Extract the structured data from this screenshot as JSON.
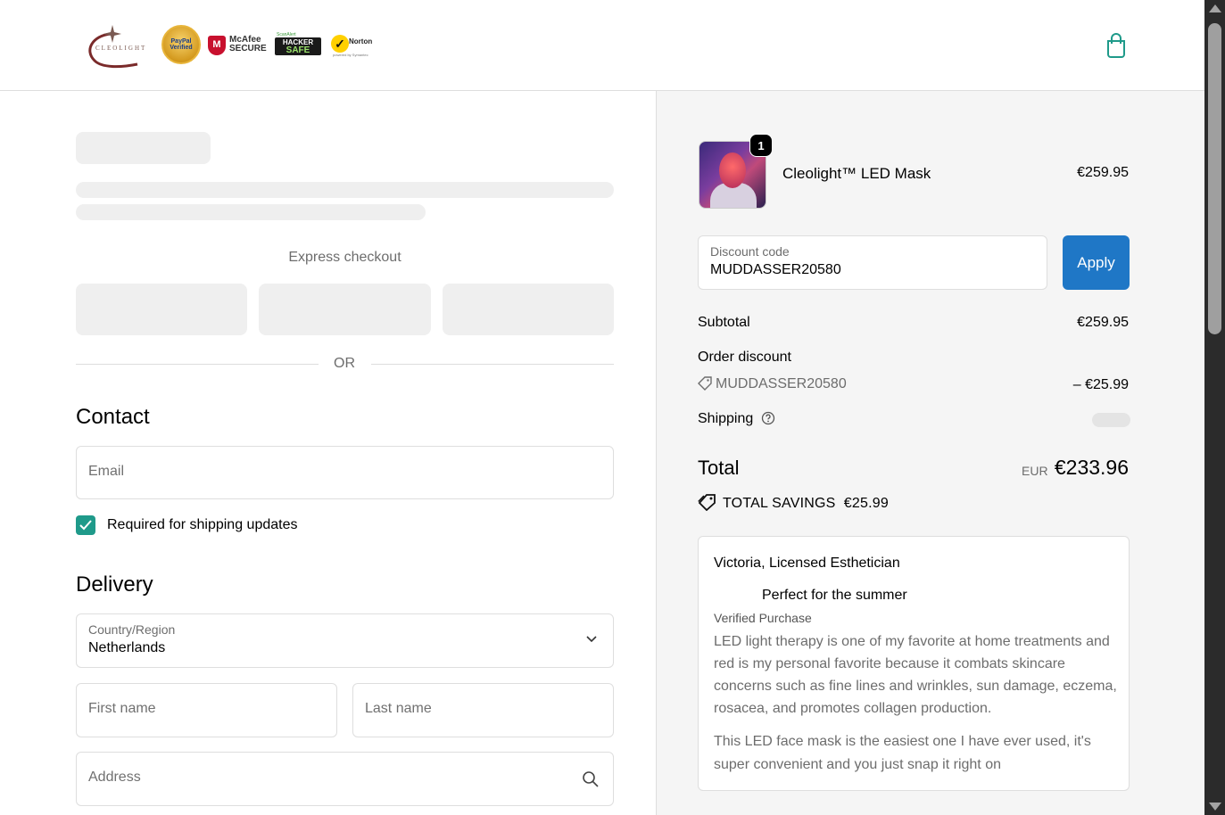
{
  "header": {
    "logo_text": "CLEOLIGHT",
    "logo_icon": "cleolight-logo-icon",
    "trust_badges": {
      "paypal": "PayPal Verified",
      "mcafee": "McAfee SECURE",
      "hacker_top": "ScanAlert",
      "hacker_line1": "HACKER",
      "hacker_line2": "SAFE",
      "norton": "Norton",
      "norton_sub": "SECURED",
      "norton_powered": "powered by Symantec"
    },
    "cart_icon": "shopping-bag-icon"
  },
  "checkout": {
    "express_label": "Express checkout",
    "or_label": "OR",
    "contact_title": "Contact",
    "email_placeholder": "Email",
    "shipping_updates_label": "Required for shipping updates",
    "shipping_updates_checked": true,
    "delivery_title": "Delivery",
    "country_label": "Country/Region",
    "country_value": "Netherlands",
    "first_name_placeholder": "First name",
    "last_name_placeholder": "Last name",
    "address_placeholder": "Address"
  },
  "summary": {
    "product": {
      "name": "Cleolight™ LED Mask",
      "price": "€259.95",
      "quantity": "1"
    },
    "discount": {
      "label": "Discount code",
      "value": "MUDDASSER20580",
      "apply_label": "Apply"
    },
    "subtotal_label": "Subtotal",
    "subtotal_value": "€259.95",
    "order_discount_label": "Order discount",
    "discount_code": "MUDDASSER20580",
    "discount_amount": "– €25.99",
    "shipping_label": "Shipping",
    "total_label": "Total",
    "total_currency": "EUR",
    "total_value": "€233.96",
    "savings_label": "TOTAL SAVINGS",
    "savings_value": "€25.99"
  },
  "review": {
    "author": "Victoria, Licensed Esthetician",
    "title": "Perfect for the summer",
    "verified": "Verified Purchase",
    "body1": "LED light therapy is one of my favorite at home treatments and red is my personal favorite because it combats skincare concerns such as fine lines and wrinkles, sun damage, eczema, rosacea, and promotes collagen production.",
    "body2": "This LED face mask is the easiest one I have ever used, it's super convenient and you just snap it right on"
  },
  "colors": {
    "accent": "#1f9a8a",
    "apply_button": "#1f77c6",
    "summary_bg": "#f5f5f5"
  }
}
